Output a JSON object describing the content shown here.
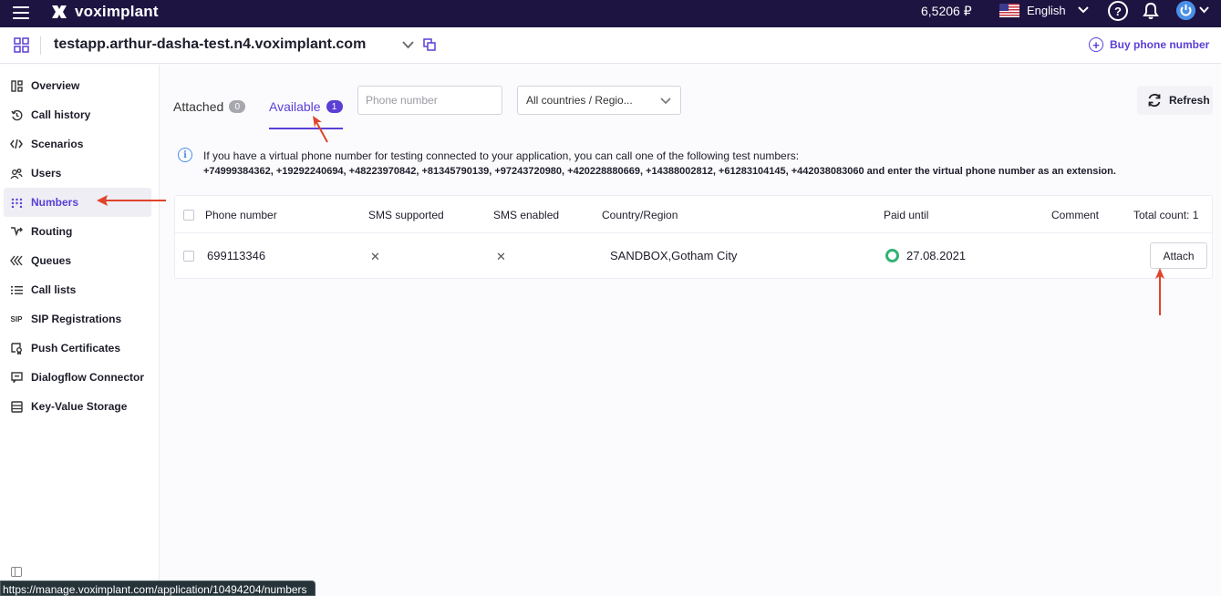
{
  "topbar": {
    "logo_text": "voximplant",
    "balance": "6,5206 ₽",
    "language": "English",
    "help_glyph": "?"
  },
  "appbar": {
    "app_title": "testapp.arthur-dasha-test.n4.voximplant.com",
    "buy_label": "Buy phone number"
  },
  "sidebar": {
    "items": [
      {
        "label": "Overview",
        "icon": "overview-icon"
      },
      {
        "label": "Call history",
        "icon": "history-icon"
      },
      {
        "label": "Scenarios",
        "icon": "code-icon"
      },
      {
        "label": "Users",
        "icon": "users-icon"
      },
      {
        "label": "Numbers",
        "icon": "dialpad-icon",
        "active": true
      },
      {
        "label": "Routing",
        "icon": "routing-icon"
      },
      {
        "label": "Queues",
        "icon": "queues-icon"
      },
      {
        "label": "Call lists",
        "icon": "list-icon"
      },
      {
        "label": "SIP Registrations",
        "icon": "sip-icon",
        "icon_text": "SIP"
      },
      {
        "label": "Push Certificates",
        "icon": "certificate-icon"
      },
      {
        "label": "Dialogflow Connector",
        "icon": "connector-icon"
      },
      {
        "label": "Key-Value Storage",
        "icon": "storage-icon"
      }
    ]
  },
  "tabs": {
    "attached_label": "Attached",
    "attached_count": "0",
    "available_label": "Available",
    "available_count": "1"
  },
  "filters": {
    "phone_placeholder": "Phone number",
    "country_value": "All countries / Regio..."
  },
  "refresh_label": "Refresh",
  "info": {
    "line1": "If you have a virtual phone number for testing connected to your application, you can call one of the following test numbers:",
    "line2": "+74999384362, +19292240694, +48223970842, +81345790139, +97243720980, +420228880669, +14388002812, +61283104145, +442038083060 and enter the virtual phone number as an extension."
  },
  "table": {
    "headers": {
      "phone": "Phone number",
      "sms_supported": "SMS supported",
      "sms_enabled": "SMS enabled",
      "country": "Country/Region",
      "paid_until": "Paid until",
      "comment": "Comment",
      "total": "Total count: 1"
    },
    "rows": [
      {
        "phone": "699113346",
        "sms_supported": "✕",
        "sms_enabled": "✕",
        "country": "SANDBOX,Gotham City",
        "paid_until": "27.08.2021",
        "action": "Attach"
      }
    ]
  },
  "status_url": "https://manage.voximplant.com/application/10494204/numbers",
  "colors": {
    "topbar_bg": "#1d1442",
    "accent": "#5b3fd6",
    "status_active": "#33b174",
    "annotation_arrow": "#e0442c"
  }
}
